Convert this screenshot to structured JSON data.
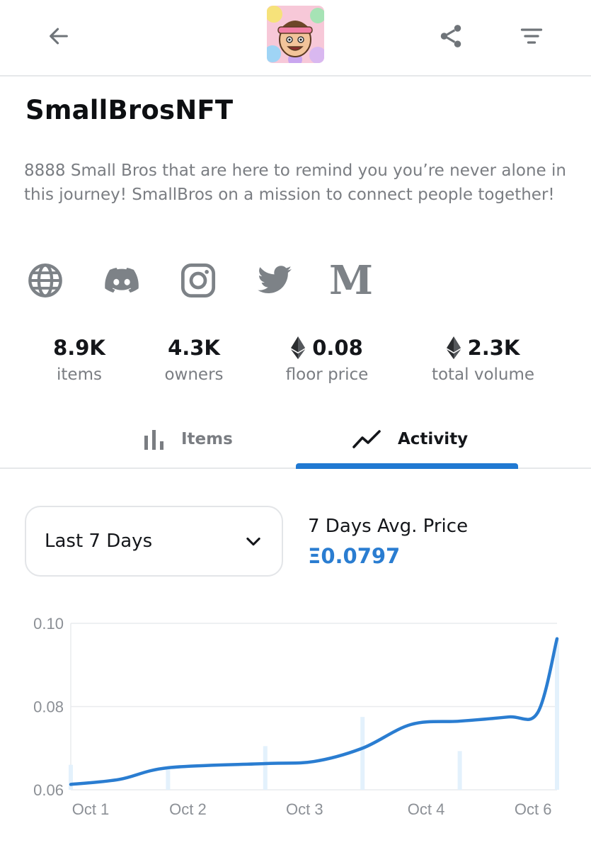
{
  "header": {
    "back_icon": "arrow-left-icon",
    "share_icon": "share-icon",
    "filter_icon": "filter-icon",
    "avatar_icon": "collection-avatar"
  },
  "collection": {
    "name": "SmallBrosNFT",
    "description": "8888 Small Bros that are here to remind you you’re never alone in this journey! SmallBros on a mission to connect people together!"
  },
  "socials": [
    "globe-icon",
    "discord-icon",
    "instagram-icon",
    "twitter-icon",
    "medium-icon"
  ],
  "medium_letter": "M",
  "stats": [
    {
      "value": "8.9K",
      "label": "items"
    },
    {
      "value": "4.3K",
      "label": "owners"
    },
    {
      "value": "0.08",
      "label": "floor price"
    },
    {
      "value": "2.3K",
      "label": "total volume"
    }
  ],
  "tabs": [
    {
      "label": "Items",
      "active": false
    },
    {
      "label": "Activity",
      "active": true
    }
  ],
  "filter": {
    "selected": "Last 7 Days"
  },
  "average": {
    "label": "7 Days Avg. Price",
    "value": "Ξ0.0797"
  },
  "colors": {
    "accent": "#2079d2",
    "muted_text": "#7a7d82",
    "icon_gray": "#7d8287"
  },
  "chart_data": {
    "type": "line",
    "x_ticks": [
      "Oct 1",
      "Oct 2",
      "Oct 3",
      "Oct 4",
      "Oct 6"
    ],
    "y_ticks": [
      "0.10",
      "0.08",
      "0.06"
    ],
    "ylim": [
      0.06,
      0.1
    ],
    "series": [
      {
        "x": [
          0,
          0.5,
          1,
          2,
          2.5,
          3,
          3.5,
          4,
          4.5,
          4.8,
          5
        ],
        "y": [
          0.0613,
          0.0625,
          0.0653,
          0.0663,
          0.0668,
          0.07,
          0.0757,
          0.0765,
          0.0775,
          0.0785,
          0.0963
        ]
      }
    ],
    "volume_bars": [
      {
        "x": 0,
        "y": 0.066
      },
      {
        "x": 1,
        "y": 0.065
      },
      {
        "x": 2,
        "y": 0.0705
      },
      {
        "x": 3,
        "y": 0.0775
      },
      {
        "x": 4,
        "y": 0.0693
      },
      {
        "x": 5,
        "y": 0.096
      }
    ],
    "grid": true
  }
}
